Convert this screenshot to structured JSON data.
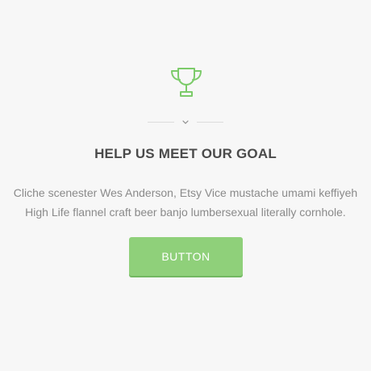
{
  "icon": "trophy-icon",
  "divider_icon": "chevron-down-icon",
  "colors": {
    "accent": "#8fd07a",
    "title": "#4a4a4a",
    "text": "#8a8a8a",
    "background": "#f7f7f7"
  },
  "heading": "HELP US MEET OUR GOAL",
  "description": {
    "line1": "Cliche scenester Wes Anderson, Etsy Vice mustache umami keffiyeh",
    "line2": "High Life flannel craft beer banjo lumbersexual literally cornhole."
  },
  "cta": {
    "label": "BUTTON"
  }
}
